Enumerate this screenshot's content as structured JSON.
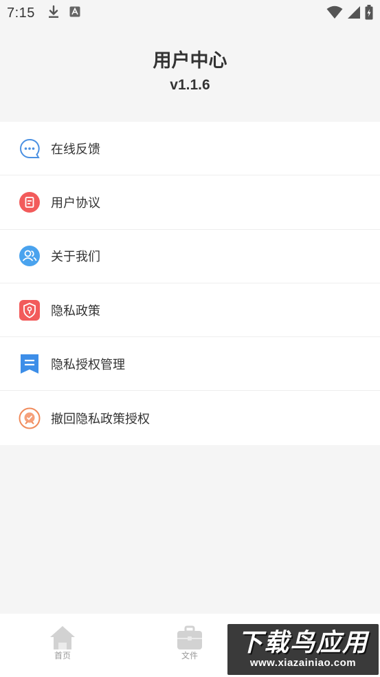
{
  "status": {
    "time": "7:15"
  },
  "header": {
    "title": "用户中心",
    "version": "v1.1.6"
  },
  "menu": {
    "items": [
      {
        "label": "在线反馈",
        "icon": "chat-bubble-icon",
        "color": "#4a90e2"
      },
      {
        "label": "用户协议",
        "icon": "document-icon",
        "color": "#f25b5b"
      },
      {
        "label": "关于我们",
        "icon": "users-icon",
        "color": "#4aa3ee"
      },
      {
        "label": "隐私政策",
        "icon": "shield-icon",
        "color": "#f25b5b"
      },
      {
        "label": "隐私授权管理",
        "icon": "list-bookmark-icon",
        "color": "#3d8ee8"
      },
      {
        "label": "撤回隐私政策授权",
        "icon": "badge-revoke-icon",
        "color": "#f08a5a"
      }
    ]
  },
  "bottom_nav": {
    "items": [
      {
        "label": "首页",
        "icon": "home-icon"
      },
      {
        "label": "文件",
        "icon": "briefcase-icon"
      }
    ]
  },
  "watermark": {
    "title": "下载鸟应用",
    "url": "www.xiazainiao.com"
  }
}
